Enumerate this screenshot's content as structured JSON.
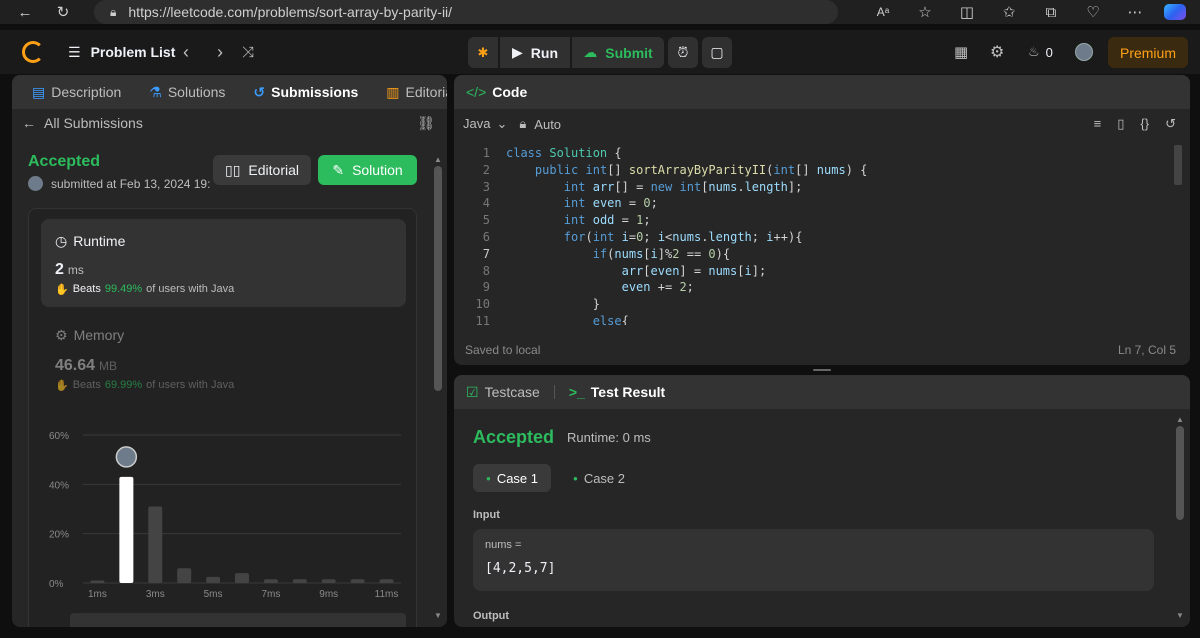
{
  "browser": {
    "url": "https://leetcode.com/problems/sort-array-by-parity-ii/"
  },
  "nav": {
    "problem_list": "Problem List",
    "run": "Run",
    "submit": "Submit",
    "fire_count": "0",
    "premium": "Premium"
  },
  "left": {
    "tabs": [
      "Description",
      "Solutions",
      "Submissions",
      "Editorial"
    ],
    "all_submissions": "All Submissions",
    "status": "Accepted",
    "submitted_at": "submitted at Feb 13, 2024 19:",
    "editorial_btn": "Editorial",
    "solution_btn": "Solution",
    "runtime_label": "Runtime",
    "runtime_value": "2",
    "runtime_unit": "ms",
    "runtime_beats_label": "Beats",
    "runtime_beats_value": "99.49%",
    "runtime_beats_suffix": "of users with Java",
    "memory_label": "Memory",
    "memory_value": "46.64",
    "memory_unit": "MB",
    "memory_beats_label": "Beats",
    "memory_beats_value": "69.99%",
    "memory_beats_suffix": "of users with Java"
  },
  "chart_data": {
    "type": "bar",
    "categories": [
      "1ms",
      "2ms",
      "3ms",
      "4ms",
      "5ms",
      "6ms",
      "7ms",
      "8ms",
      "9ms",
      "10ms",
      "11ms"
    ],
    "x_tick_labels": [
      "1ms",
      "3ms",
      "5ms",
      "7ms",
      "9ms",
      "11ms"
    ],
    "values": [
      1,
      43,
      31,
      6,
      2.5,
      4,
      1.5,
      1.5,
      1.5,
      1.5,
      1.5
    ],
    "highlight_index": 1,
    "y_ticks": [
      "60%",
      "40%",
      "20%",
      "0%"
    ],
    "ylim": [
      0,
      60
    ],
    "grid": true,
    "colors": {
      "highlight": "#ffffff",
      "bar": "#444444",
      "grid": "#3a3a3a"
    }
  },
  "code": {
    "header": "Code",
    "language": "Java",
    "mode": "Auto",
    "lines": [
      "class Solution {",
      "    public int[] sortArrayByParityII(int[] nums) {",
      "        int arr[] = new int[nums.length];",
      "        int even = 0;",
      "        int odd = 1;",
      "        for(int i=0; i<nums.length; i++){",
      "            if(nums[i]%2 == 0){",
      "                arr[even] = nums[i];",
      "                even += 2;",
      "            }",
      "            else{"
    ],
    "saved": "Saved to local",
    "cursor": "Ln 7, Col 5"
  },
  "test": {
    "tab_testcase": "Testcase",
    "tab_result": "Test Result",
    "status": "Accepted",
    "runtime": "Runtime: 0 ms",
    "case1": "Case 1",
    "case2": "Case 2",
    "input_label": "Input",
    "var_name": "nums =",
    "var_value": "[4,2,5,7]",
    "output_label": "Output"
  },
  "colors": {
    "accent_green": "#2cbb5d",
    "brand_orange": "#ffa116",
    "blue": "#3c9cff"
  }
}
